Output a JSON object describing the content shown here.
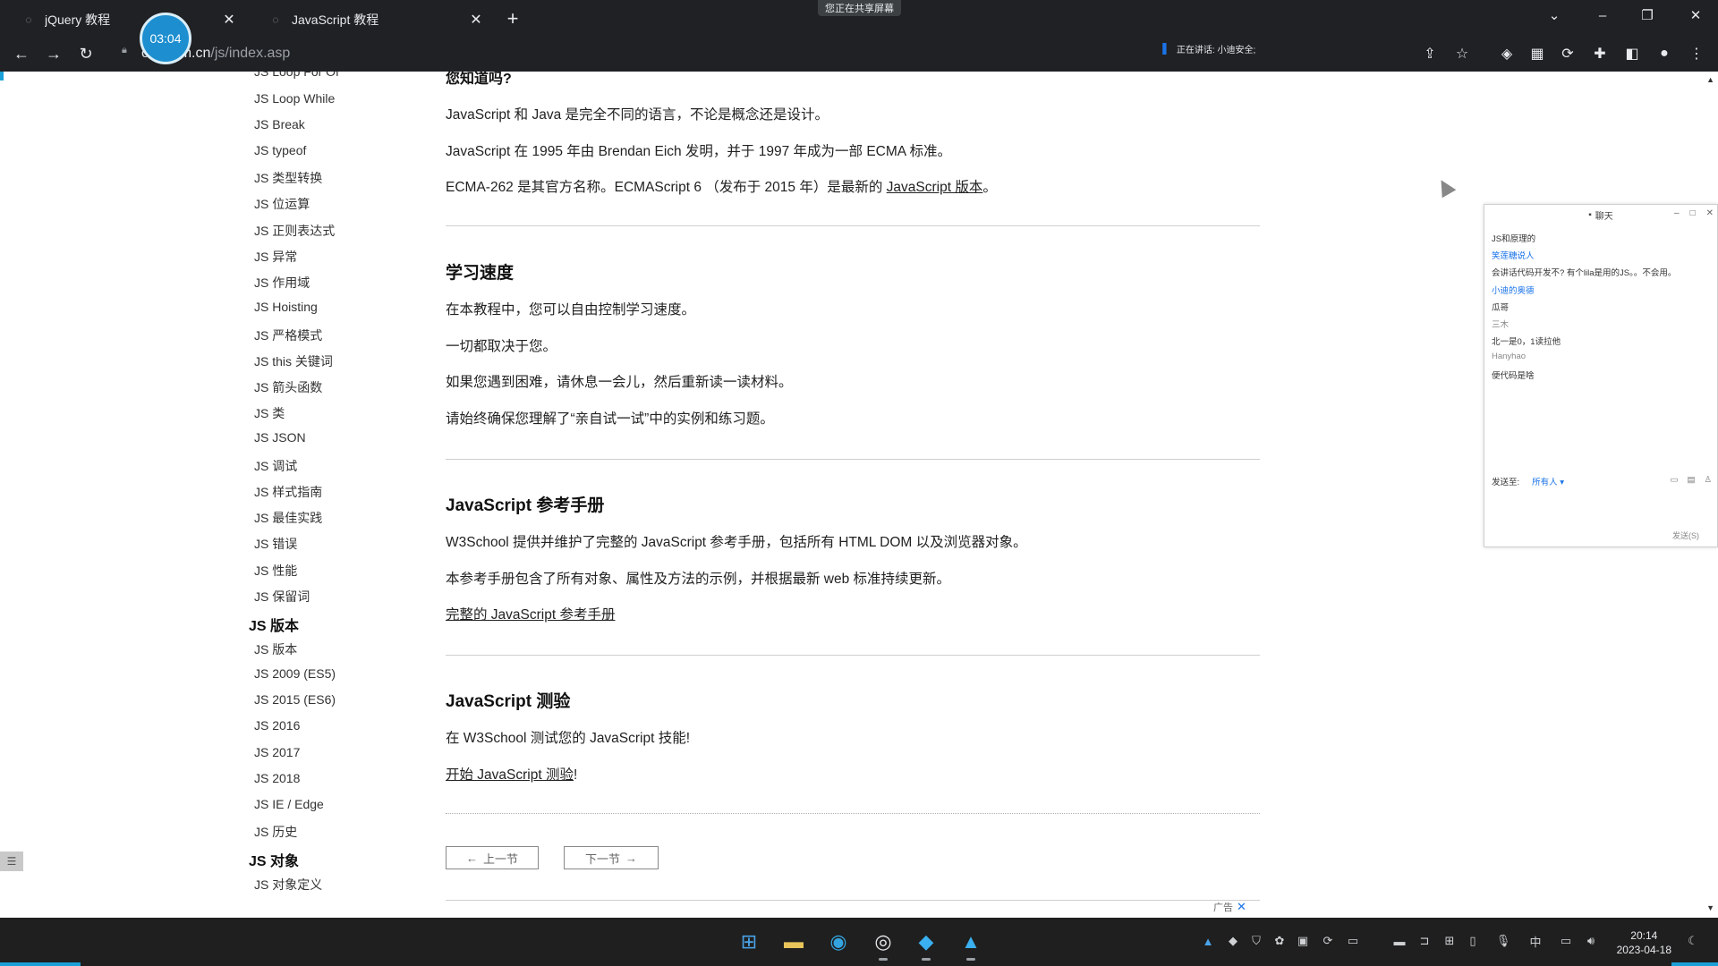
{
  "browser": {
    "tabs": [
      {
        "label": "jQuery 教程",
        "active": false
      },
      {
        "label": "JavaScript 教程",
        "active": true
      }
    ],
    "sharing_banner": "您正在共享屏幕",
    "url_host": "ool.com.cn",
    "url_path": "/js/index.asp",
    "speaking_text": "正在讲话: 小迪安全;"
  },
  "timer": "03:04",
  "sidebar": {
    "items": [
      {
        "type": "link",
        "label": "JS Loop For Of"
      },
      {
        "type": "link",
        "label": "JS Loop While"
      },
      {
        "type": "link",
        "label": "JS Break"
      },
      {
        "type": "link",
        "label": "JS typeof"
      },
      {
        "type": "link",
        "label": "JS 类型转换"
      },
      {
        "type": "link",
        "label": "JS 位运算"
      },
      {
        "type": "link",
        "label": "JS 正则表达式"
      },
      {
        "type": "link",
        "label": "JS 异常"
      },
      {
        "type": "link",
        "label": "JS 作用域"
      },
      {
        "type": "link",
        "label": "JS Hoisting"
      },
      {
        "type": "link",
        "label": "JS 严格模式"
      },
      {
        "type": "link",
        "label": "JS this 关键词"
      },
      {
        "type": "link",
        "label": "JS 箭头函数"
      },
      {
        "type": "link",
        "label": "JS 类"
      },
      {
        "type": "link",
        "label": "JS JSON"
      },
      {
        "type": "link",
        "label": "JS 调试"
      },
      {
        "type": "link",
        "label": "JS 样式指南"
      },
      {
        "type": "link",
        "label": "JS 最佳实践"
      },
      {
        "type": "link",
        "label": "JS 错误"
      },
      {
        "type": "link",
        "label": "JS 性能"
      },
      {
        "type": "link",
        "label": "JS 保留词"
      },
      {
        "type": "heading",
        "label": "JS 版本"
      },
      {
        "type": "link",
        "label": "JS 版本"
      },
      {
        "type": "link",
        "label": "JS 2009 (ES5)"
      },
      {
        "type": "link",
        "label": "JS 2015 (ES6)"
      },
      {
        "type": "link",
        "label": "JS 2016"
      },
      {
        "type": "link",
        "label": "JS 2017"
      },
      {
        "type": "link",
        "label": "JS 2018"
      },
      {
        "type": "link",
        "label": "JS IE / Edge"
      },
      {
        "type": "link",
        "label": "JS 历史"
      },
      {
        "type": "heading",
        "label": "JS 对象"
      },
      {
        "type": "link",
        "label": "JS 对象定义"
      }
    ]
  },
  "main": {
    "did_you_know": {
      "title": "您知道吗?",
      "p1": "JavaScript 和 Java 是完全不同的语言，不论是概念还是设计。",
      "p2": "JavaScript 在 1995 年由 Brendan Eich 发明，并于 1997 年成为一部 ECMA 标准。",
      "p3_before": "ECMA-262 是其官方名称。ECMAScript 6 （发布于 2015 年）是最新的 ",
      "p3_link": "JavaScript 版本",
      "p3_after": "。"
    },
    "speed": {
      "title": "学习速度",
      "p1": "在本教程中，您可以自由控制学习速度。",
      "p2": "一切都取决于您。",
      "p3": "如果您遇到困难，请休息一会儿，然后重新读一读材料。",
      "p4": "请始终确保您理解了“亲自试一试”中的实例和练习题。"
    },
    "reference": {
      "title": "JavaScript 参考手册",
      "p1": "W3School 提供并维护了完整的 JavaScript 参考手册，包括所有 HTML DOM 以及浏览器对象。",
      "p2": "本参考手册包含了所有对象、属性及方法的示例，并根据最新 web 标准持续更新。",
      "link": "完整的 JavaScript 参考手册"
    },
    "quiz": {
      "title": "JavaScript 测验",
      "p1": "在 W3School 测试您的 JavaScript 技能!",
      "link": "开始 JavaScript 测验",
      "link_after": "!"
    },
    "pager": {
      "prev": "上一节",
      "next": "下一节"
    },
    "ad_label": "广告"
  },
  "chat": {
    "title": "聊天",
    "lines": [
      {
        "text": "JS和原理的",
        "style": "normal"
      },
      {
        "text": "笑莲糖说人",
        "style": "name"
      },
      {
        "text": "会讲话代码开发不? 有个lila是用的JS。。不会用。",
        "style": "normal"
      },
      {
        "text": "小迪的奥德",
        "style": "name"
      },
      {
        "text": "瓜哥",
        "style": "normal"
      },
      {
        "text": "三木",
        "style": "gray"
      },
      {
        "text": "北一是0，1读拉他",
        "style": "normal"
      },
      {
        "text": "Hanyhao",
        "style": "gray"
      },
      {
        "text": "便代码是啥",
        "style": "normal"
      }
    ],
    "send_to_label": "发送至:",
    "send_to_value": "所有人",
    "send_button": "发送(S)"
  },
  "taskbar": {
    "time": "20:14",
    "date": "2023-04-18",
    "ime": "中"
  },
  "colors": {
    "accent": "#1aa0d8",
    "timer_bg": "#1d8fd0"
  }
}
